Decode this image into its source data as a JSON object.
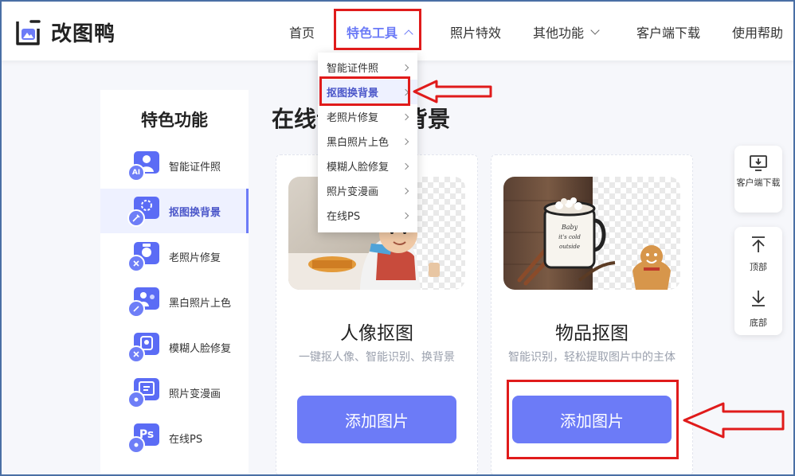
{
  "brand": {
    "name": "改图鸭",
    "accent": "#6c7bf7",
    "annotation_red": "#e01b1b"
  },
  "nav": {
    "items": [
      {
        "label": "首页"
      },
      {
        "label": "特色工具",
        "active": true,
        "icon": "chevron-up-icon"
      },
      {
        "label": "照片特效"
      },
      {
        "label": "其他功能",
        "icon": "chevron-down-icon"
      },
      {
        "label": "客户端下载"
      },
      {
        "label": "使用帮助"
      }
    ]
  },
  "dropdown": {
    "items": [
      {
        "label": "智能证件照"
      },
      {
        "label": "抠图换背景",
        "active": true
      },
      {
        "label": "老照片修复"
      },
      {
        "label": "黑白照片上色"
      },
      {
        "label": "模糊人脸修复"
      },
      {
        "label": "照片变漫画"
      },
      {
        "label": "在线PS"
      }
    ]
  },
  "sidebar": {
    "title": "特色功能",
    "items": [
      {
        "label": "智能证件照",
        "icon": "id-photo-icon",
        "badge": "AI"
      },
      {
        "label": "抠图换背景",
        "icon": "cutout-icon",
        "active": true
      },
      {
        "label": "老照片修复",
        "icon": "old-photo-icon"
      },
      {
        "label": "黑白照片上色",
        "icon": "colorize-icon"
      },
      {
        "label": "模糊人脸修复",
        "icon": "face-restore-icon"
      },
      {
        "label": "照片变漫画",
        "icon": "cartoon-icon"
      },
      {
        "label": "在线PS",
        "icon": "ps-icon",
        "badge": "Ps"
      }
    ]
  },
  "main": {
    "title": "在线证件照换背景",
    "cards": [
      {
        "title": "人像抠图",
        "desc": "一键抠人像、智能识别、换背景",
        "button": "添加图片"
      },
      {
        "title": "物品抠图",
        "desc": "智能识别，轻松提取图片中的主体",
        "button": "添加图片",
        "mug_text": "Baby it's cold outside"
      }
    ]
  },
  "floating": {
    "download_label": "客户端下载",
    "top_label": "顶部",
    "bottom_label": "底部"
  }
}
